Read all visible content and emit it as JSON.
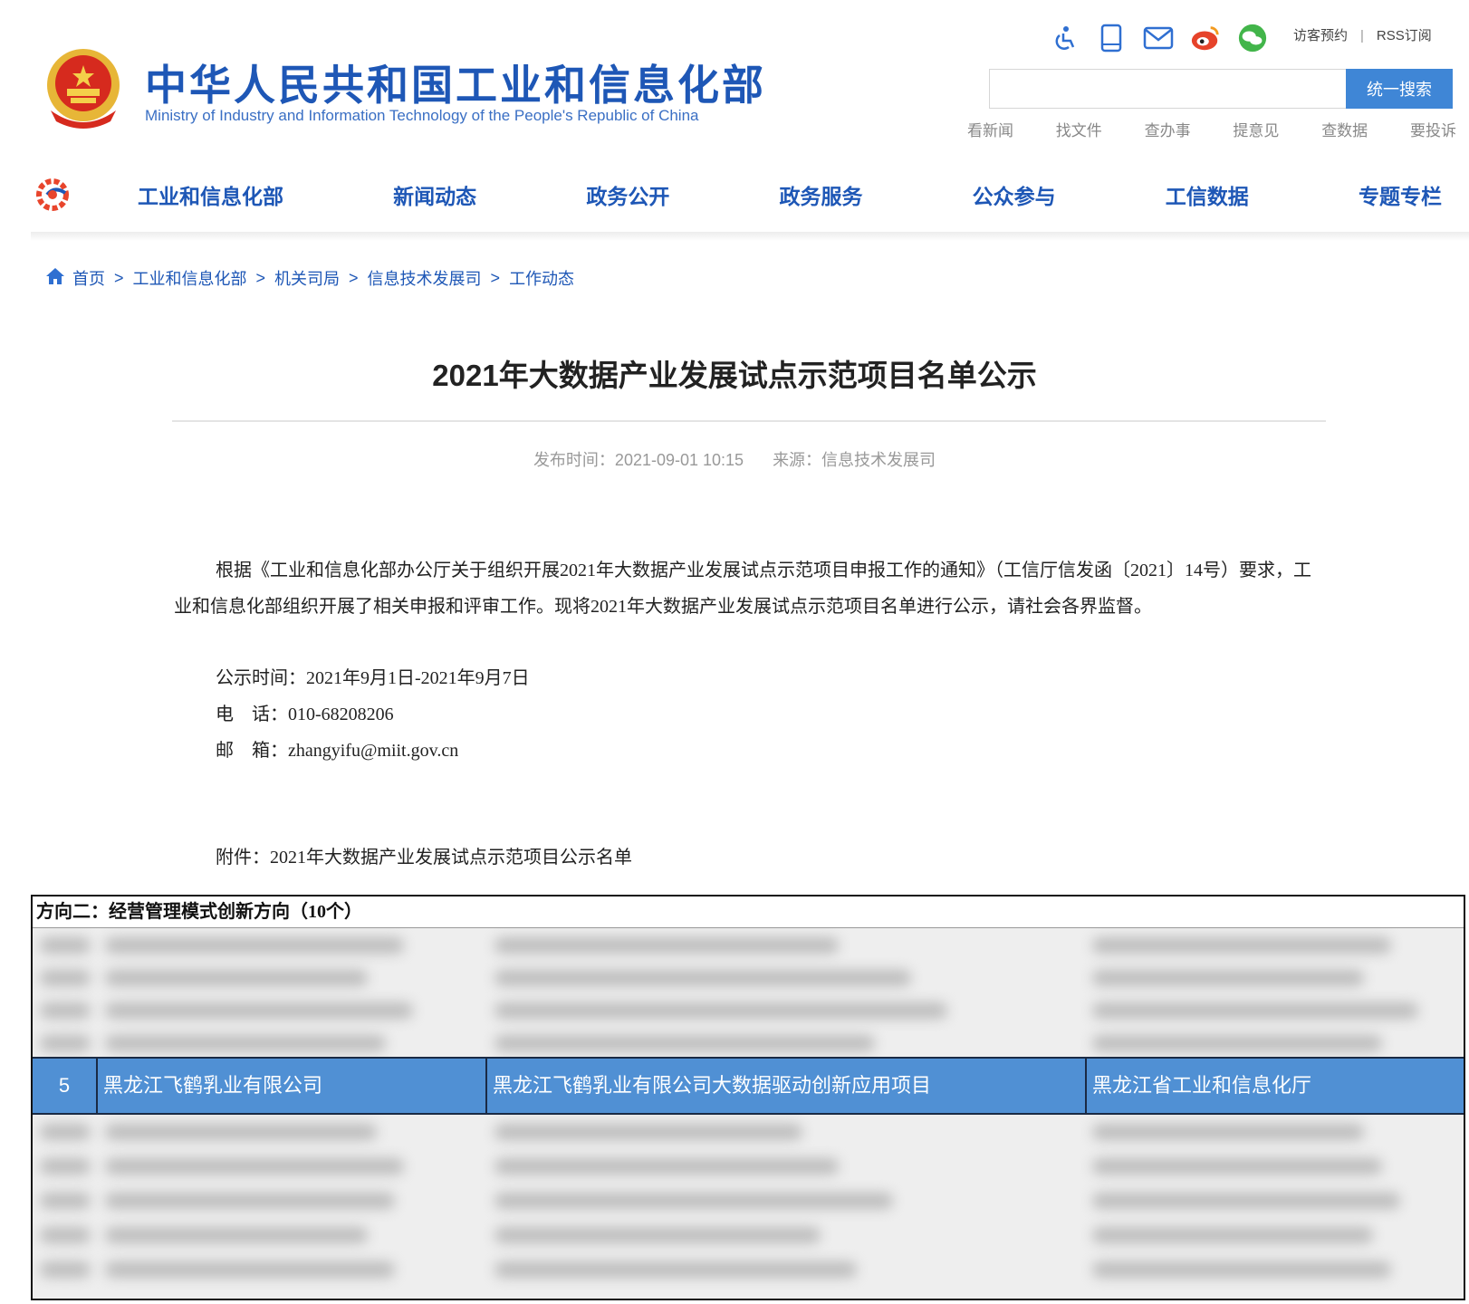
{
  "header": {
    "title_cn": "中华人民共和国工业和信息化部",
    "title_en": "Ministry of Industry and Information Technology of the People's Republic of China",
    "top_links": [
      "访客预约",
      "RSS订阅"
    ],
    "search": {
      "button_label": "统一搜索",
      "placeholder": ""
    },
    "quick_links": [
      "看新闻",
      "找文件",
      "查办事",
      "提意见",
      "查数据",
      "要投诉"
    ],
    "icons": [
      "accessibility-icon",
      "mobile-icon",
      "mail-icon",
      "weibo-icon",
      "wechat-icon"
    ]
  },
  "nav": {
    "items": [
      "工业和信息化部",
      "新闻动态",
      "政务公开",
      "政务服务",
      "公众参与",
      "工信数据",
      "专题专栏"
    ]
  },
  "breadcrumb": [
    "首页",
    "工业和信息化部",
    "机关司局",
    "信息技术发展司",
    "工作动态"
  ],
  "article": {
    "title": "2021年大数据产业发展试点示范项目名单公示",
    "publish_label": "发布时间：2021-09-01 10:15",
    "source_label": "来源：信息技术发展司",
    "paragraph": "根据《工业和信息化部办公厅关于组织开展2021年大数据产业发展试点示范项目申报工作的通知》（工信厅信发函〔2021〕14号）要求，工业和信息化部组织开展了相关申报和评审工作。现将2021年大数据产业发展试点示范项目名单进行公示，请社会各界监督。",
    "notice_time": "公示时间：2021年9月1日-2021年9月7日",
    "phone": "电　话：010-68208206",
    "email": "邮　箱：zhangyifu@miit.gov.cn",
    "attachment": "附件：2021年大数据产业发展试点示范项目公示名单"
  },
  "table": {
    "heading": "方向二：经营管理模式创新方向（10个）",
    "highlighted_row": {
      "no": "5",
      "company": "黑龙江飞鹤乳业有限公司",
      "project": "黑龙江飞鹤乳业有限公司大数据驱动创新应用项目",
      "recommender": "黑龙江省工业和信息化厅"
    }
  },
  "colors": {
    "brand_blue": "#1e57b6",
    "search_button": "#3f86d6",
    "highlight_row": "#5090d4"
  }
}
